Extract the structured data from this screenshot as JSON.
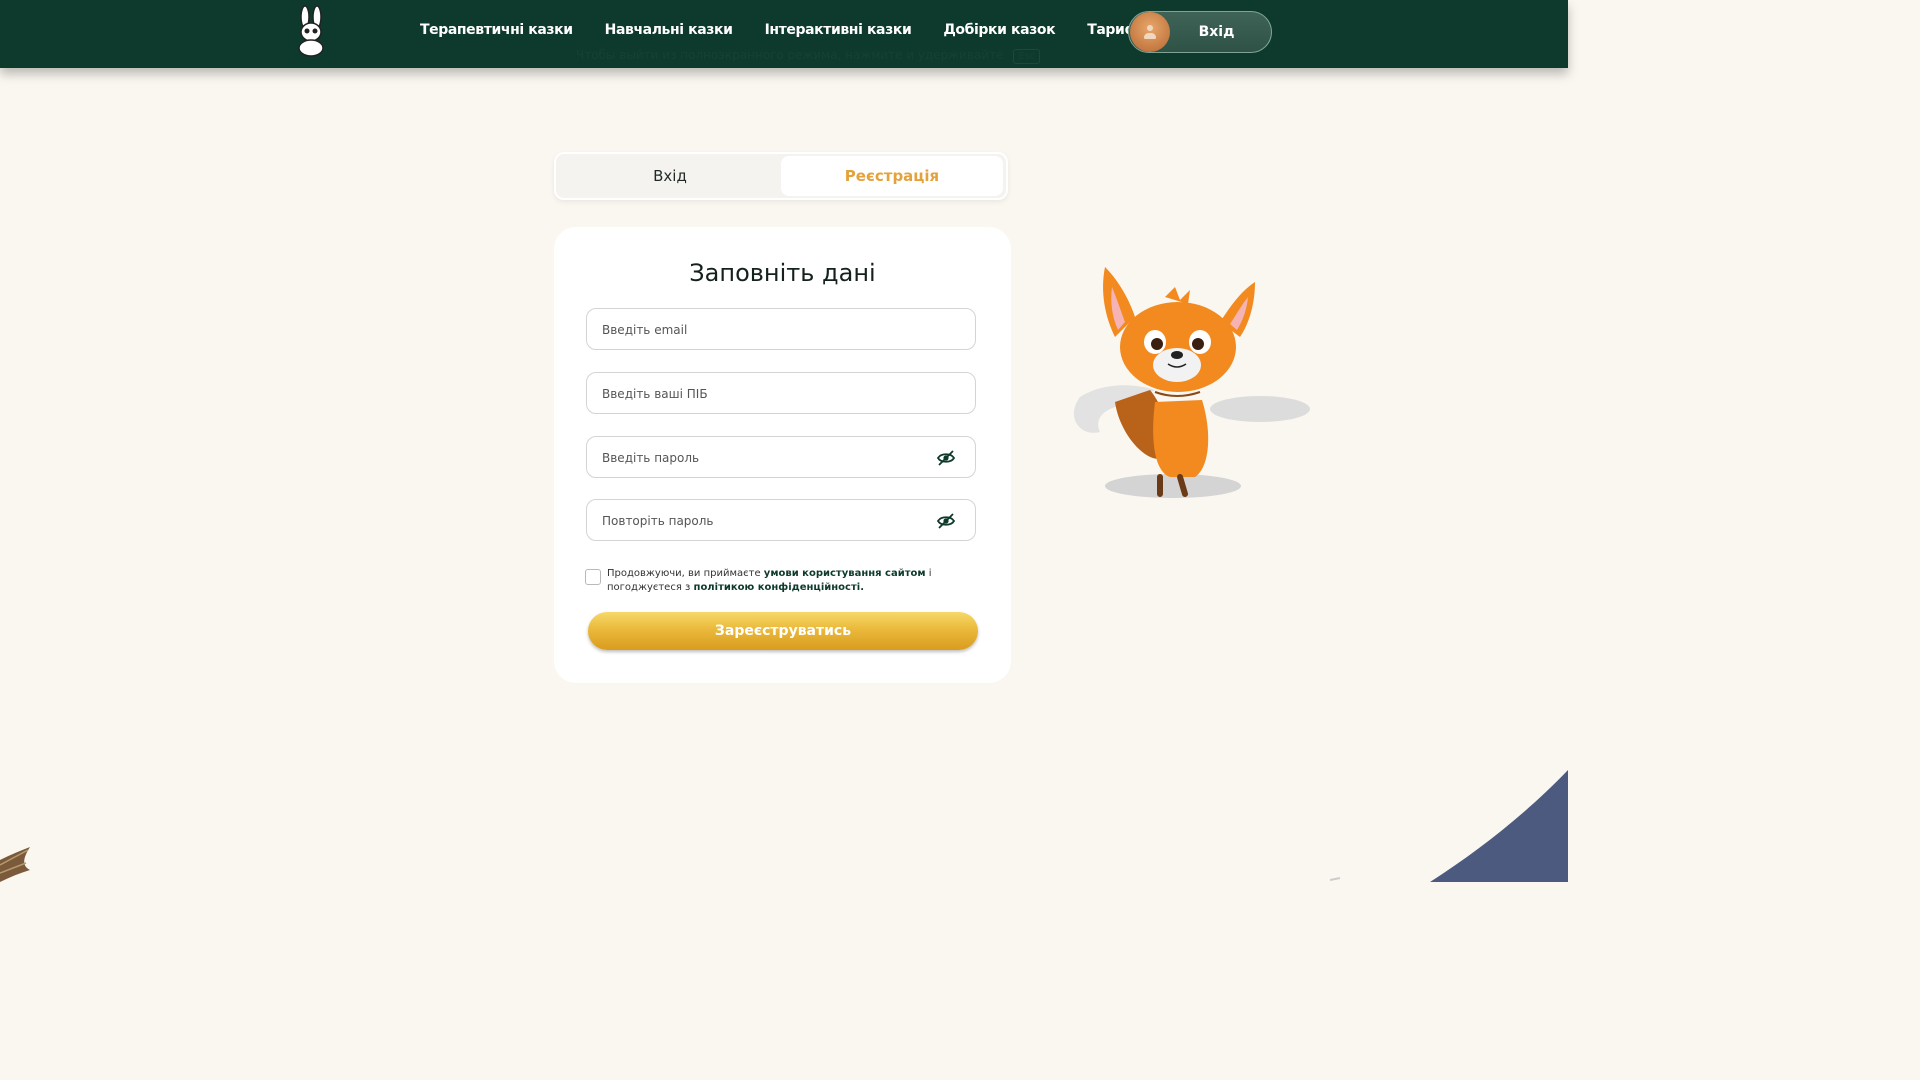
{
  "header": {
    "nav": [
      "Терапевтичні казки",
      "Навчальні казки",
      "Інтерактивні казки",
      "Добірки казок",
      "Тарифи"
    ],
    "login_label": "Вхід",
    "esc_hint": "Чтобы выйти из полноэкранного режима, нажмите и удерживайте",
    "esc_key": "Esc"
  },
  "tabs": {
    "login": "Вхід",
    "register": "Реєстрація",
    "active": "register"
  },
  "form": {
    "title": "Заповніть дані",
    "email_placeholder": "Введіть email",
    "name_placeholder": "Введіть ваші ПІБ",
    "password_placeholder": "Введіть пароль",
    "repeat_placeholder": "Повторіть пароль",
    "consent": {
      "prefix": "Продовжуючи, ви приймаєте ",
      "terms": "умови користування сайтом",
      "middle": " і погоджуєтеся з ",
      "privacy": "політикою конфіденційності",
      "suffix": "."
    },
    "submit": "Зареєструватись"
  },
  "colors": {
    "header_bg": "#0d3a2c",
    "accent": "#e3a23b",
    "page_bg": "#faf7f0"
  },
  "icons": {
    "logo": "bunny-logo-icon",
    "password_toggle": "eye-slash-icon",
    "avatar": "user-avatar-icon"
  }
}
